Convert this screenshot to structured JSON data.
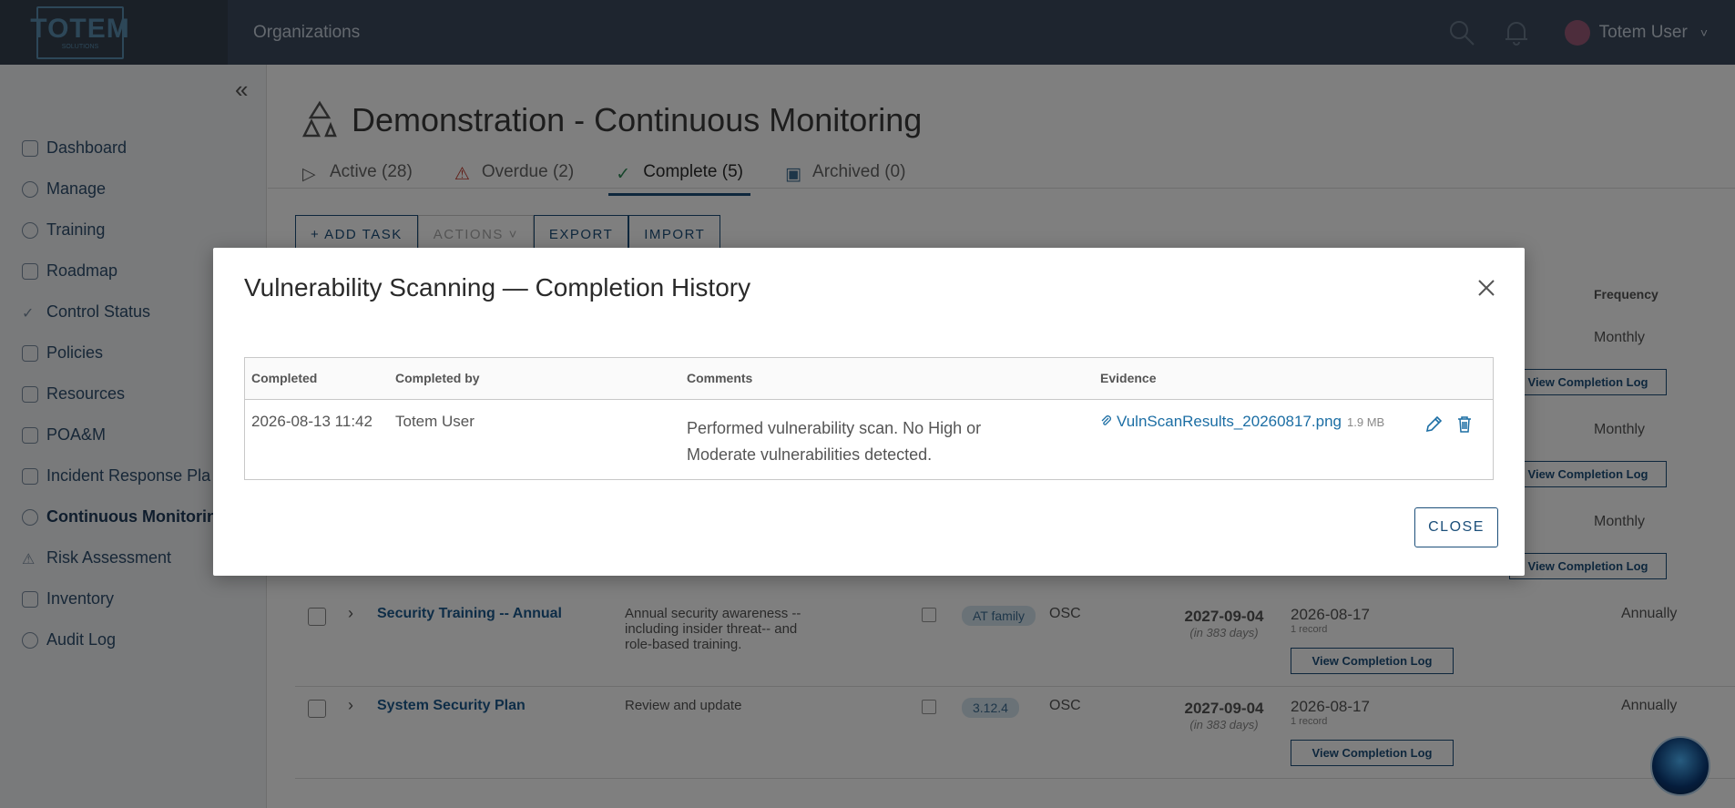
{
  "topbar": {
    "logo_text": "TOTEM",
    "logo_sub": "SOLUTIONS",
    "org_link": "Organizations",
    "user_name": "Totem User",
    "search_icon": "search-icon",
    "bell_icon": "bell-icon"
  },
  "sidebar": {
    "items": [
      {
        "label": "Dashboard",
        "icon": "dashboard-icon"
      },
      {
        "label": "Manage",
        "icon": "gear-icon"
      },
      {
        "label": "Training",
        "icon": "lightbulb-icon"
      },
      {
        "label": "Roadmap",
        "icon": "map-icon"
      },
      {
        "label": "Control Status",
        "icon": "check-icon"
      },
      {
        "label": "Policies",
        "icon": "document-icon"
      },
      {
        "label": "Resources",
        "icon": "folder-icon"
      },
      {
        "label": "POA&M",
        "icon": "clipboard-icon"
      },
      {
        "label": "Incident Response Pla",
        "icon": "shield-icon"
      },
      {
        "label": "Continuous Monitorin",
        "icon": "cycle-icon"
      },
      {
        "label": "Risk Assessment",
        "icon": "warning-icon"
      },
      {
        "label": "Inventory",
        "icon": "inventory-icon"
      },
      {
        "label": "Audit Log",
        "icon": "history-icon"
      }
    ]
  },
  "main": {
    "title": "Demonstration - Continuous Monitoring",
    "tabs": [
      {
        "label": "Active (28)"
      },
      {
        "label": "Overdue (2)"
      },
      {
        "label": "Complete (5)"
      },
      {
        "label": "Archived (0)"
      }
    ],
    "toolbar": {
      "add_task": "+ ADD TASK",
      "actions": "ACTIONS ˅",
      "export": "EXPORT",
      "import": "IMPORT"
    },
    "frequency_header": "Frequency",
    "hidden_rows": [
      {
        "frequency": "Monthly",
        "log_label": "View Completion Log"
      },
      {
        "frequency": "Monthly",
        "log_label": "View Completion Log"
      },
      {
        "frequency": "Monthly",
        "log_label": "View Completion Log"
      }
    ],
    "rows": [
      {
        "name": "Security Training -- Annual",
        "description": "Annual security awareness --including insider threat-- and role-based training.",
        "badge": "AT family",
        "responsible": "OSC",
        "due": "2027-09-04",
        "due_sub": "(in 383 days)",
        "last": "2026-08-17",
        "last_sub": "1 record",
        "log_label": "View Completion Log",
        "frequency": "Annually"
      },
      {
        "name": "System Security Plan",
        "description": "Review and update",
        "badge": "3.12.4",
        "responsible": "OSC",
        "due": "2027-09-04",
        "due_sub": "(in 383 days)",
        "last": "2026-08-17",
        "last_sub": "1 record",
        "log_label": "View Completion Log",
        "frequency": "Annually"
      }
    ]
  },
  "modal": {
    "title": "Vulnerability Scanning — Completion History",
    "columns": {
      "completed": "Completed",
      "completed_by": "Completed by",
      "comments": "Comments",
      "evidence": "Evidence"
    },
    "entry": {
      "completed": "2026-08-13 11:42",
      "completed_by": "Totem User",
      "comments": "Performed vulnerability scan. No High or Moderate vulnerabilities detected.",
      "evidence_file": "VulnScanResults_20260817.png",
      "evidence_size": "1.9 MB"
    },
    "close_label": "CLOSE"
  }
}
